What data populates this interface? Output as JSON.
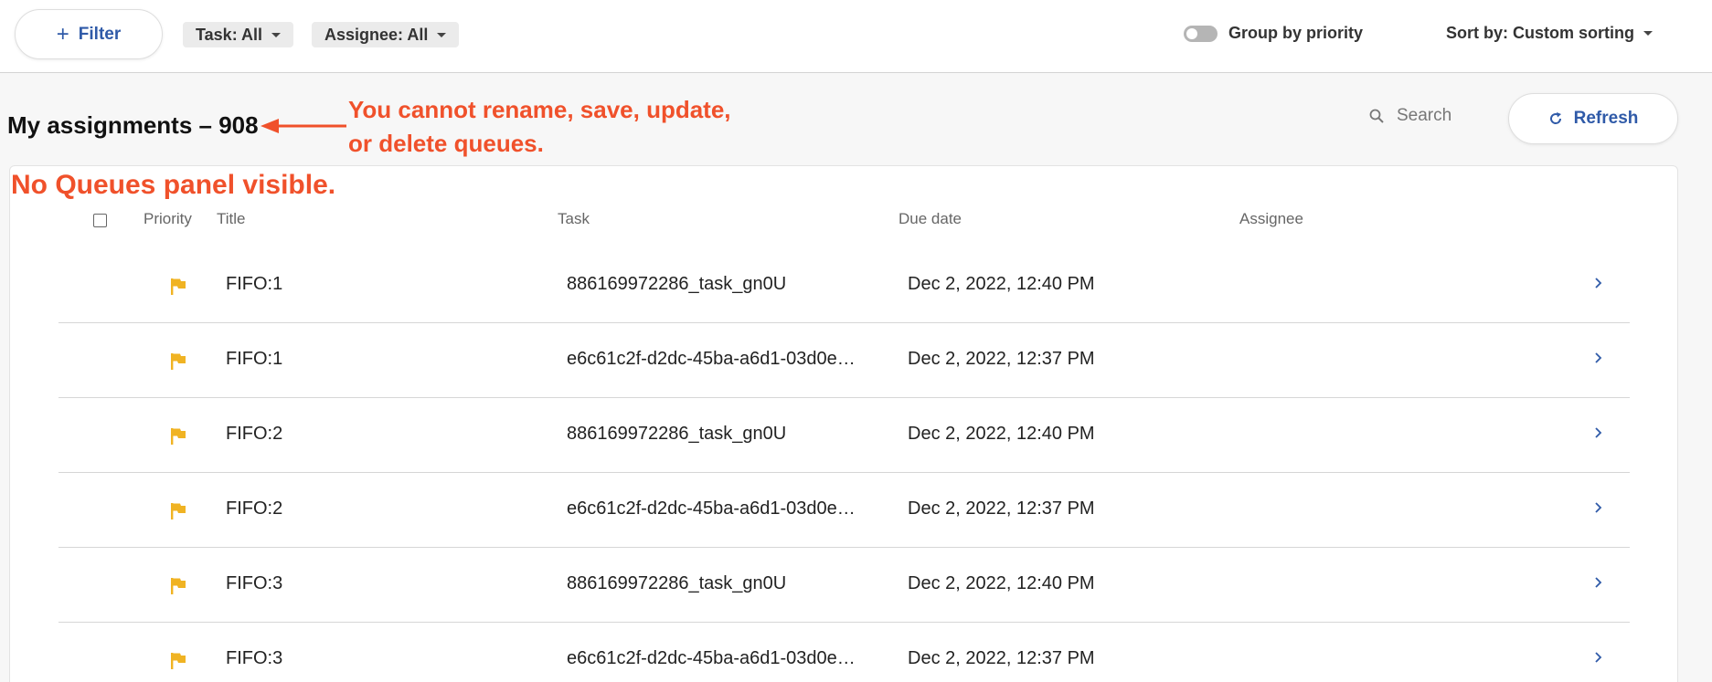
{
  "toolbar": {
    "filter_label": "Filter",
    "task_filter": "Task: All",
    "assignee_filter": "Assignee: All",
    "group_by_label": "Group by priority",
    "sort_label": "Sort by: Custom sorting"
  },
  "header": {
    "title": "My assignments – 908",
    "search_placeholder": "Search",
    "refresh_label": "Refresh"
  },
  "annotations": {
    "note_1_line_1": "You cannot rename, save, update,",
    "note_1_line_2": "or delete queues.",
    "note_2": "No Queues panel visible."
  },
  "table": {
    "columns": {
      "priority": "Priority",
      "title": "Title",
      "task": "Task",
      "due_date": "Due date",
      "assignee": "Assignee"
    },
    "rows": [
      {
        "title": "FIFO:1",
        "task": "886169972286_task_gn0U",
        "due": "Dec 2, 2022, 12:40 PM",
        "assignee": ""
      },
      {
        "title": "FIFO:1",
        "task": "e6c61c2f-d2dc-45ba-a6d1-03d0e…",
        "due": "Dec 2, 2022, 12:37 PM",
        "assignee": ""
      },
      {
        "title": "FIFO:2",
        "task": "886169972286_task_gn0U",
        "due": "Dec 2, 2022, 12:40 PM",
        "assignee": ""
      },
      {
        "title": "FIFO:2",
        "task": "e6c61c2f-d2dc-45ba-a6d1-03d0e…",
        "due": "Dec 2, 2022, 12:37 PM",
        "assignee": ""
      },
      {
        "title": "FIFO:3",
        "task": "886169972286_task_gn0U",
        "due": "Dec 2, 2022, 12:40 PM",
        "assignee": ""
      },
      {
        "title": "FIFO:3",
        "task": "e6c61c2f-d2dc-45ba-a6d1-03d0e…",
        "due": "Dec 2, 2022, 12:37 PM",
        "assignee": ""
      }
    ]
  },
  "colors": {
    "accent": "#2f5aa8",
    "flag": "#f0b323",
    "annotation": "#f0512b"
  },
  "icons": {
    "filter": "plus-icon",
    "dropdown": "caret-down-icon",
    "search": "search-icon",
    "refresh": "refresh-icon",
    "priority": "flag-icon",
    "row_action": "chevron-right-icon"
  }
}
